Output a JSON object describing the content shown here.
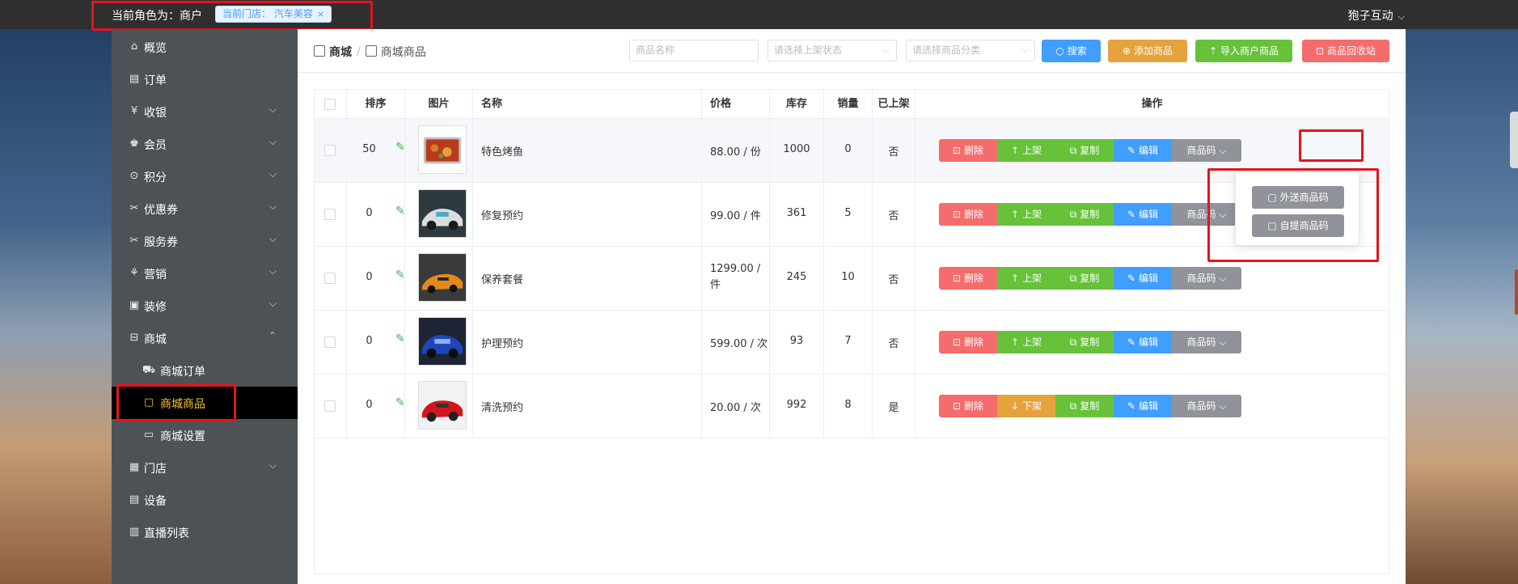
{
  "topbar": {
    "role_label": "当前角色为：商户",
    "store_tag": "当前门店： 汽车美容",
    "store_tag_close": "×",
    "user": "狍子互动"
  },
  "sidebar": {
    "items": [
      {
        "label": "概览",
        "icon": "home-icon"
      },
      {
        "label": "订单",
        "icon": "order-icon"
      },
      {
        "label": "收银",
        "icon": "cashier-icon"
      },
      {
        "label": "会员",
        "icon": "member-icon"
      },
      {
        "label": "积分",
        "icon": "points-icon"
      },
      {
        "label": "优惠券",
        "icon": "coupon-icon"
      },
      {
        "label": "服务券",
        "icon": "ticket-icon"
      },
      {
        "label": "营销",
        "icon": "marketing-icon"
      },
      {
        "label": "装修",
        "icon": "decor-icon"
      },
      {
        "label": "商城",
        "icon": "mall-icon"
      },
      {
        "label": "商城订单",
        "icon": "cart-icon"
      },
      {
        "label": "商城商品",
        "icon": "bag-icon"
      },
      {
        "label": "商城设置",
        "icon": "settings-icon"
      },
      {
        "label": "门店",
        "icon": "store-icon"
      },
      {
        "label": "设备",
        "icon": "device-icon"
      },
      {
        "label": "直播列表",
        "icon": "live-icon"
      }
    ]
  },
  "breadcrumb": {
    "root": "商城",
    "current": "商城商品"
  },
  "filters": {
    "name_placeholder": "商品名称",
    "status_placeholder": "请选择上架状态",
    "category_placeholder": "请选择商品分类"
  },
  "toolbar": {
    "search": "搜索",
    "add": "添加商品",
    "import": "导入商户商品",
    "recycle": "商品回收站"
  },
  "table": {
    "headers": [
      "排序",
      "图片",
      "名称",
      "价格",
      "库存",
      "销量",
      "已上架",
      "操作"
    ],
    "rows": [
      {
        "sort": "50",
        "name": "特色烤鱼",
        "price": "88.00 / 份",
        "stock": "1000",
        "sales": "0",
        "on_shelf": "否",
        "toggle": "上架"
      },
      {
        "sort": "0",
        "name": "修复预约",
        "price": "99.00 / 件",
        "stock": "361",
        "sales": "5",
        "on_shelf": "否",
        "toggle": "上架"
      },
      {
        "sort": "0",
        "name": "保养套餐",
        "price": "1299.00 / 件",
        "stock": "245",
        "sales": "10",
        "on_shelf": "否",
        "toggle": "上架"
      },
      {
        "sort": "0",
        "name": "护理预约",
        "price": "599.00 / 次",
        "stock": "93",
        "sales": "7",
        "on_shelf": "否",
        "toggle": "上架"
      },
      {
        "sort": "0",
        "name": "清洗预约",
        "price": "20.00 / 次",
        "stock": "992",
        "sales": "8",
        "on_shelf": "是",
        "toggle": "下架"
      }
    ],
    "ops": {
      "delete": "删除",
      "copy": "复制",
      "edit": "编辑",
      "code": "商品码"
    }
  },
  "dropdown": {
    "delivery_code": "外送商品码",
    "pickup_code": "自提商品码"
  },
  "colors": {
    "primary": "#409eff",
    "warning": "#e6a23c",
    "success": "#67c23a",
    "danger": "#f56c6c",
    "info": "#909399",
    "active_menu": "#f5c52e"
  }
}
